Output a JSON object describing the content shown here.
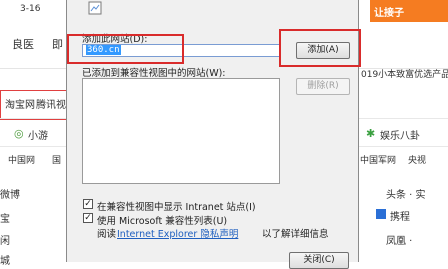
{
  "background": {
    "date_fragment": "3-16",
    "nav_items": [
      "良医",
      "即"
    ],
    "ad_text": "019小本致富优选产品",
    "ad_badge": "让接子",
    "shortcut_items": [
      "淘宝网",
      "腾讯视"
    ],
    "weather_left": "小游",
    "weather_right": "娱乐八卦",
    "site_row": [
      "中国网",
      "国",
      "中国军网",
      "央视"
    ],
    "left_column": [
      "微博",
      "宝",
      "闲",
      "城"
    ],
    "right_column": [
      "头条 · 实",
      "携程",
      "凤凰 ·"
    ]
  },
  "dialog": {
    "add_site_label": "添加此网站(D):",
    "add_site_value": "360.cn",
    "add_button": "添加(A)",
    "list_label": "已添加到兼容性视图中的网站(W):",
    "remove_button": "删除(R)",
    "option_intranet": "在兼容性视图中显示 Intranet 站点(I)",
    "option_intranet_checked": true,
    "option_ms_list": "使用 Microsoft 兼容性列表(U)",
    "option_ms_list_checked": true,
    "read_prefix": "阅读",
    "privacy_link": "Internet Explorer 隐私声明",
    "read_suffix": "以了解详细信息",
    "close_button": "关闭(C)"
  },
  "colors": {
    "highlight_outline": "#d92b2b",
    "link": "#1f5fbf",
    "selection": "#3399ff"
  }
}
